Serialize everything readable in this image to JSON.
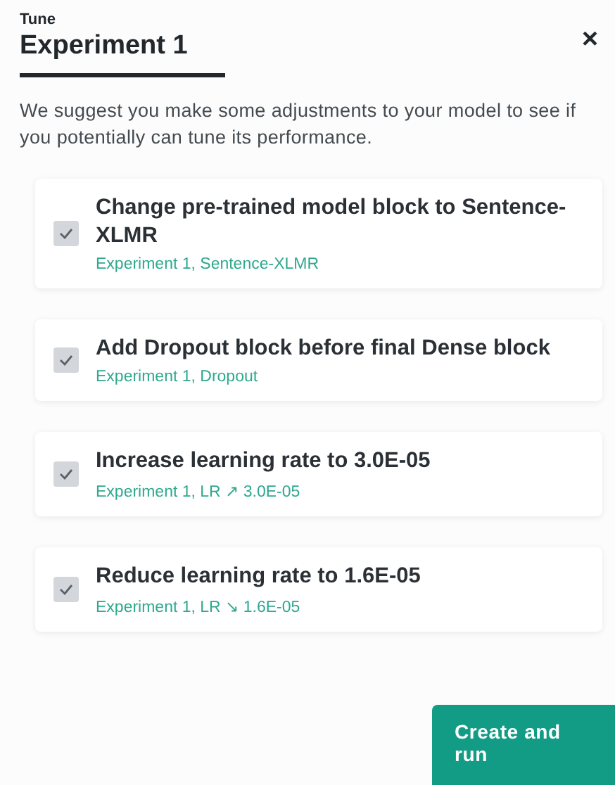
{
  "header": {
    "overline": "Tune",
    "title": "Experiment 1",
    "close": "×"
  },
  "description": "We suggest you make some adjustments to your model to see if you potentially can tune its performance.",
  "suggestions": [
    {
      "title": "Change pre-trained model block to Sentence-XLMR",
      "detail": "Experiment 1, Sentence-XLMR",
      "checked": true
    },
    {
      "title": "Add Dropout block before final Dense block",
      "detail": "Experiment 1, Dropout",
      "checked": true
    },
    {
      "title": "Increase learning rate to 3.0E-05",
      "detail": "Experiment 1, LR ↗ 3.0E-05",
      "checked": true
    },
    {
      "title": "Reduce learning rate to 1.6E-05",
      "detail": "Experiment 1, LR ↘ 1.6E-05",
      "checked": true
    }
  ],
  "primary_button": "Create and run"
}
